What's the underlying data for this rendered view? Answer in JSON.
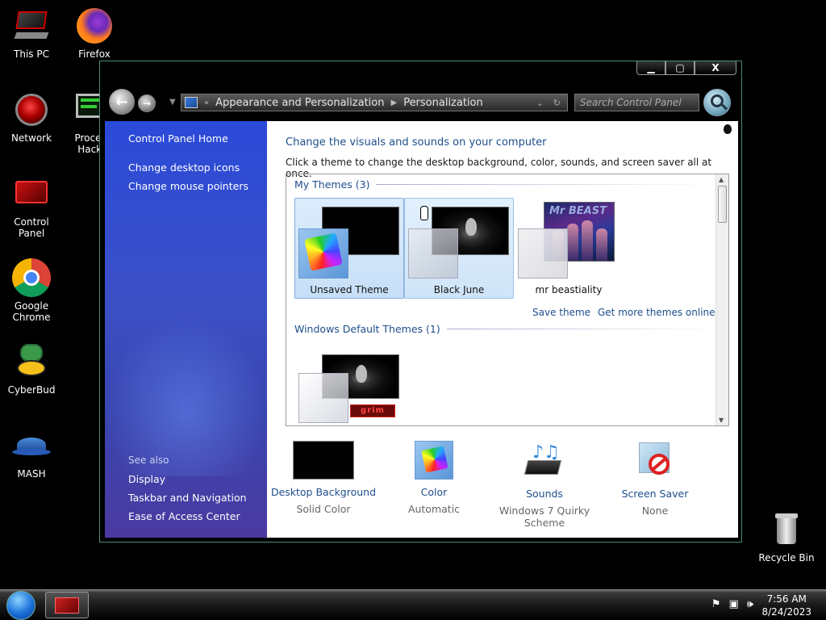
{
  "desktop": {
    "icons": [
      {
        "label": "This PC"
      },
      {
        "label": "Firefox"
      },
      {
        "label": "Network"
      },
      {
        "label": "Process Hacker"
      },
      {
        "label": "Control Panel"
      },
      {
        "label": "Google Chrome"
      },
      {
        "label": "CyberBud"
      },
      {
        "label": "MASH"
      },
      {
        "label": "Recycle Bin"
      }
    ]
  },
  "window": {
    "buttons": {
      "minimize": "▁",
      "maximize": "▢",
      "close": "X"
    },
    "address": {
      "crumbs": [
        "Appearance and Personalization",
        "Personalization"
      ]
    },
    "search": {
      "placeholder": "Search Control Panel"
    }
  },
  "sidepane": {
    "home": "Control Panel Home",
    "links": [
      "Change desktop icons",
      "Change mouse pointers"
    ],
    "see_also_label": "See also",
    "see_also": [
      "Display",
      "Taskbar and Navigation",
      "Ease of Access Center"
    ]
  },
  "content": {
    "heading": "Change the visuals and sounds on your computer",
    "subheading": "Click a theme to change the desktop background, color, sounds, and screen saver all at once.",
    "my_themes_header": "My Themes (3)",
    "my_themes": [
      {
        "name": "Unsaved Theme",
        "state": "selected"
      },
      {
        "name": "Black June",
        "state": "hover"
      },
      {
        "name": "mr beastiality",
        "state": "normal"
      }
    ],
    "beast_title": "Mr BEAST",
    "save_theme": "Save theme",
    "get_more": "Get more themes online",
    "default_header": "Windows Default Themes (1)",
    "grim_logo": "grim",
    "settings": [
      {
        "link": "Desktop Background",
        "value": "Solid Color"
      },
      {
        "link": "Color",
        "value": "Automatic"
      },
      {
        "link": "Sounds",
        "value": "Windows 7 Quirky Scheme"
      },
      {
        "link": "Screen Saver",
        "value": "None"
      }
    ]
  },
  "taskbar": {
    "time": "7:56 AM",
    "date": "8/24/2023"
  },
  "colors": {
    "link": "#1e4e8c",
    "sidepane": "#3b50c8",
    "selection": "#c6dff7"
  }
}
